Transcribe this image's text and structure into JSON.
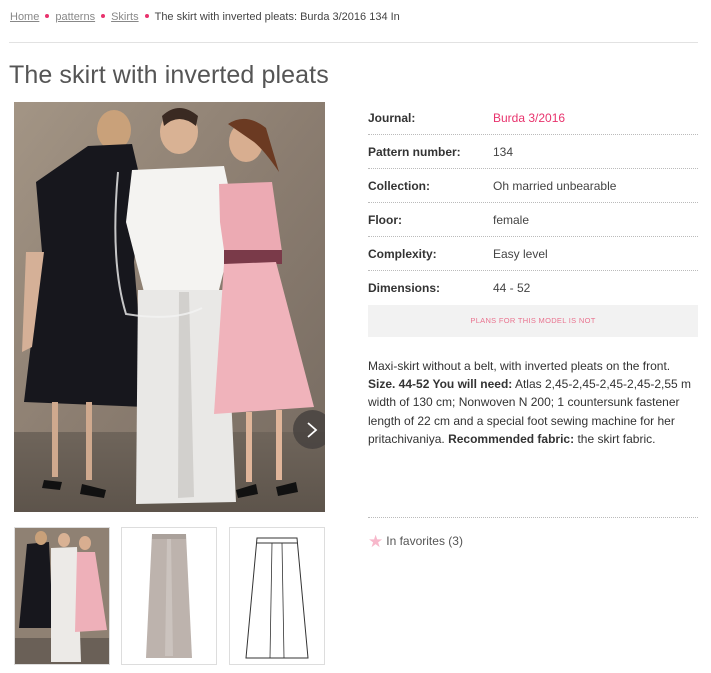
{
  "breadcrumb": {
    "items": [
      "Home",
      "patterns",
      "Skirts"
    ],
    "current": "The skirt with inverted pleats: Burda 3/2016 134 In"
  },
  "page_title": "The skirt with inverted pleats",
  "specs": [
    {
      "key": "Journal:",
      "value": "Burda 3/2016",
      "link": true
    },
    {
      "key": "Pattern number:",
      "value": "134"
    },
    {
      "key": "Collection:",
      "value": "Oh married unbearable"
    },
    {
      "key": "Floor:",
      "value": "female"
    },
    {
      "key": "Complexity:",
      "value": "Easy level"
    },
    {
      "key": "Dimensions:",
      "value": "44 - 52"
    }
  ],
  "plans_notice": "PLANS FOR THIS MODEL IS NOT",
  "description": {
    "intro": "Maxi-skirt without a belt, with inverted pleats on the front.",
    "size_label": "Size. 44-52 You will need:",
    "materials": "Atlas 2,45-2,45-2,45-2,45-2,55 m width of 130 cm; Nonwoven N 200; 1 countersunk fastener length of 22 cm and a special foot sewing machine for her pritachivaniya.",
    "fabric_label": "Recommended fabric:",
    "fabric_value": "the skirt fabric."
  },
  "favorites": {
    "icon": "star-icon",
    "label": "In favorites (3)"
  },
  "colors": {
    "accent": "#e8336d",
    "notice_text": "#e9738f"
  }
}
